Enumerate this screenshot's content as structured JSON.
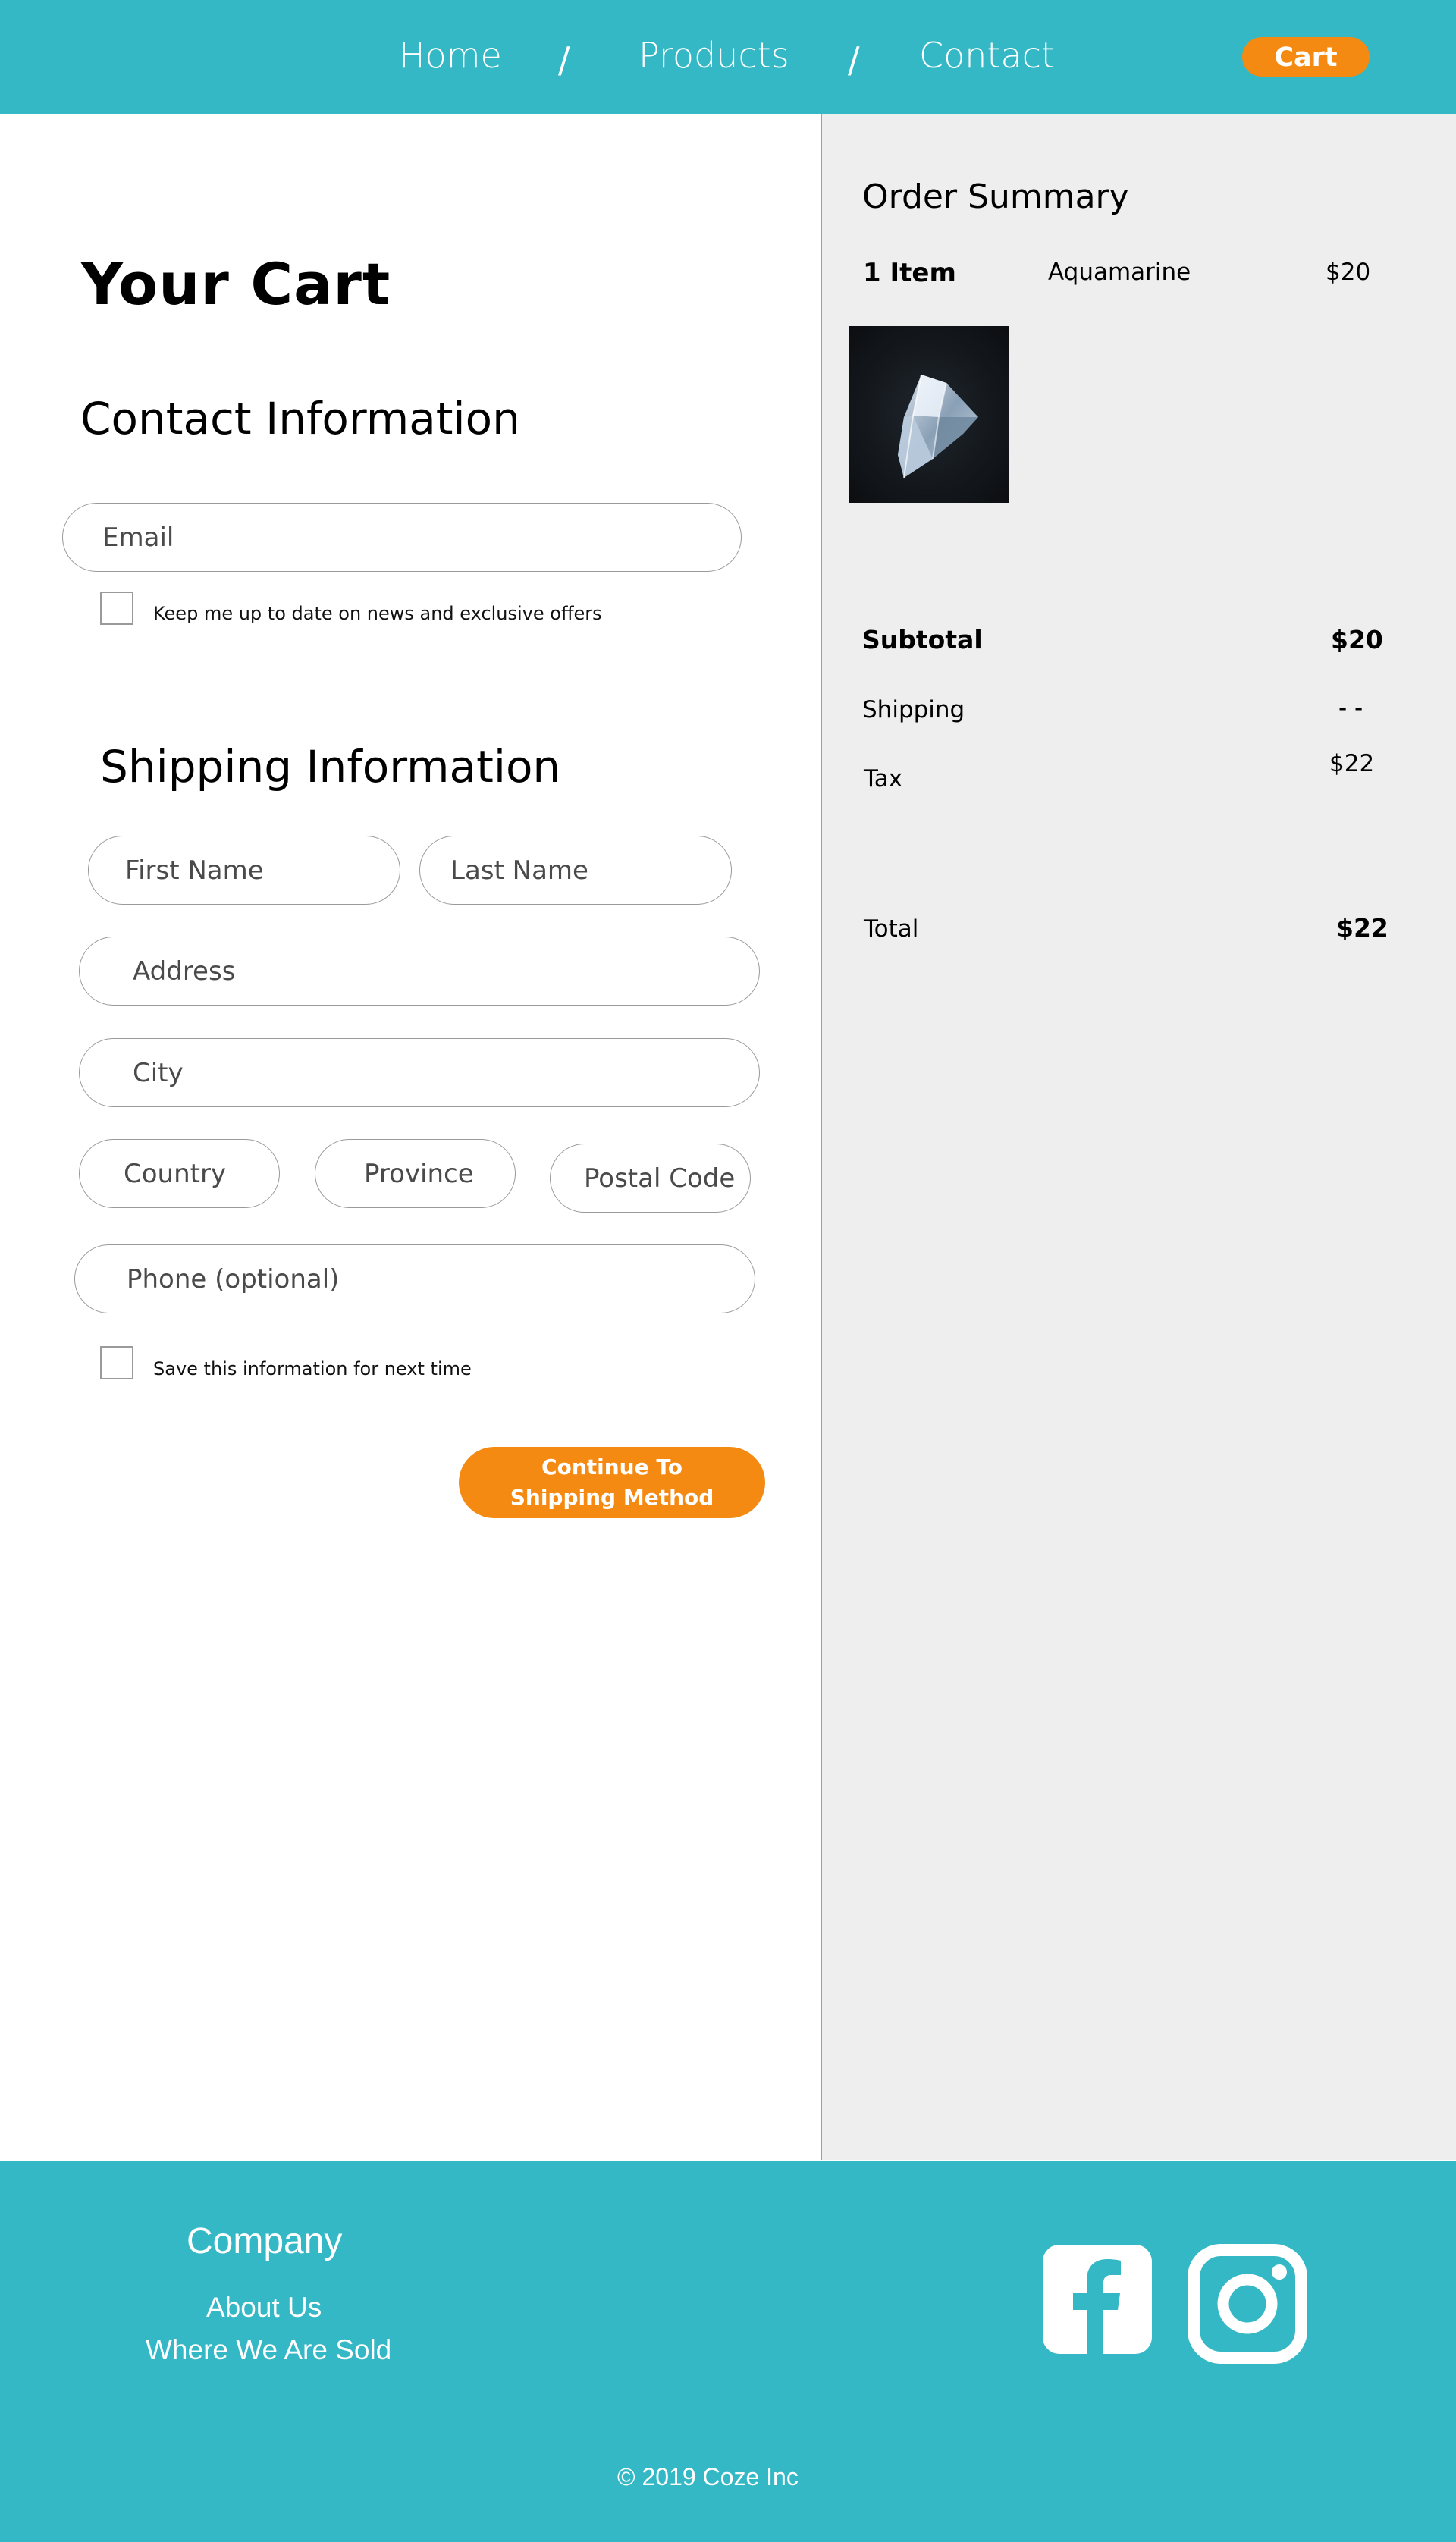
{
  "header": {
    "nav": [
      "Home",
      "Products",
      "Contact"
    ],
    "separator": "/",
    "cart_label": "Cart",
    "background": "#35b8c5",
    "accent": "#f58a12"
  },
  "cart": {
    "title": "Your Cart",
    "contact": {
      "heading": "Contact Information",
      "email_placeholder": "Email",
      "newsletter_label": "Keep me up to date on news and exclusive offers"
    },
    "shipping": {
      "heading": "Shipping Information",
      "first_name_placeholder": "First Name",
      "last_name_placeholder": "Last Name",
      "address_placeholder": "Address",
      "city_placeholder": "City",
      "country_placeholder": "Country",
      "province_placeholder": "Province",
      "postal_placeholder": "Postal Code",
      "phone_placeholder": "Phone (optional)",
      "save_label": "Save this information for next time"
    },
    "continue_line1": "Continue To",
    "continue_line2": "Shipping Method"
  },
  "summary": {
    "heading": "Order Summary",
    "item_count": "1 Item",
    "item_name": "Aquamarine",
    "item_price": "$20",
    "item_image_icon": "gemstone-image",
    "subtotal_label": "Subtotal",
    "subtotal_value": "$20",
    "shipping_label": "Shipping",
    "shipping_value": "- -",
    "tax_label": "Tax",
    "tax_value": "$22",
    "total_label": "Total",
    "total_value": "$22"
  },
  "footer": {
    "company_heading": "Company",
    "links": [
      "About Us",
      "Where We Are Sold"
    ],
    "social_icons": [
      "facebook-icon",
      "instagram-icon"
    ],
    "copyright": "© 2019 Coze Inc"
  }
}
